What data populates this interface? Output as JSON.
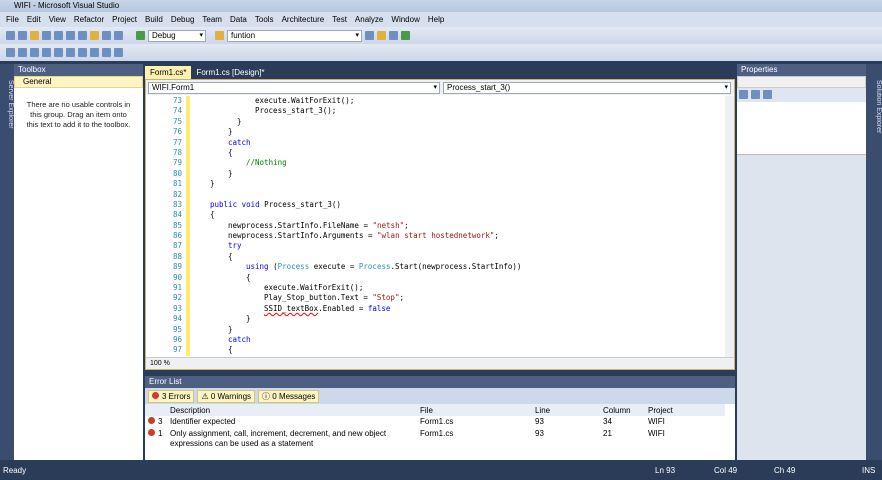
{
  "window": {
    "title": "WIFI - Microsoft Visual Studio"
  },
  "menu": [
    "File",
    "Edit",
    "View",
    "Refactor",
    "Project",
    "Build",
    "Debug",
    "Team",
    "Data",
    "Tools",
    "Architecture",
    "Test",
    "Analyze",
    "Window",
    "Help"
  ],
  "toolbar": {
    "config": "Debug",
    "find": "funtion"
  },
  "side_strips": {
    "left": "Server Explorer",
    "right": "Solution Explorer"
  },
  "toolbox": {
    "title": "Toolbox",
    "group": "General",
    "empty_text": "There are no usable controls in this group. Drag an item onto this text to add it to the toolbox."
  },
  "tabs": [
    {
      "label": "Form1.cs*",
      "active": true
    },
    {
      "label": "Form1.cs [Design]*",
      "active": false
    }
  ],
  "editor": {
    "class_combo": "WIFI.Form1",
    "member_combo": "Process_start_3()",
    "zoom": "100 %",
    "lines": [
      {
        "n": "73",
        "i": 3,
        "t": [
          [
            "",
            "execute.WaitForExit();"
          ]
        ]
      },
      {
        "n": "74",
        "i": 3,
        "t": [
          [
            "",
            "Process_start_3();"
          ]
        ]
      },
      {
        "n": "75",
        "i": 2,
        "t": [
          [
            "",
            "}"
          ]
        ]
      },
      {
        "n": "76",
        "i": 1.5,
        "t": [
          [
            "",
            "}"
          ]
        ]
      },
      {
        "n": "77",
        "i": 1.5,
        "t": [
          [
            "kw",
            "catch"
          ]
        ]
      },
      {
        "n": "78",
        "i": 1.5,
        "t": [
          [
            "",
            "{"
          ]
        ]
      },
      {
        "n": "79",
        "i": 2.5,
        "t": [
          [
            "cm",
            "//Nothing"
          ]
        ]
      },
      {
        "n": "80",
        "i": 1.5,
        "t": [
          [
            "",
            "}"
          ]
        ]
      },
      {
        "n": "81",
        "i": 0.5,
        "t": [
          [
            "",
            "}"
          ]
        ]
      },
      {
        "n": "82",
        "i": 0,
        "t": []
      },
      {
        "n": "83",
        "i": 0.5,
        "t": [
          [
            "kw",
            "public"
          ],
          [
            "",
            " "
          ],
          [
            "kw",
            "void"
          ],
          [
            "",
            " Process_start_3()"
          ]
        ]
      },
      {
        "n": "84",
        "i": 0.5,
        "t": [
          [
            "",
            "{"
          ]
        ]
      },
      {
        "n": "85",
        "i": 1.5,
        "t": [
          [
            "",
            "newprocess.StartInfo.FileName = "
          ],
          [
            "str",
            "\"netsh\""
          ],
          [
            "",
            ";"
          ]
        ]
      },
      {
        "n": "86",
        "i": 1.5,
        "t": [
          [
            "",
            "newprocess.StartInfo.Arguments = "
          ],
          [
            "str",
            "\"wlan start hostednetwork\""
          ],
          [
            "",
            ";"
          ]
        ]
      },
      {
        "n": "87",
        "i": 1.5,
        "t": [
          [
            "kw",
            "try"
          ]
        ]
      },
      {
        "n": "88",
        "i": 1.5,
        "t": [
          [
            "",
            "{"
          ]
        ]
      },
      {
        "n": "89",
        "i": 2.5,
        "t": [
          [
            "kw",
            "using"
          ],
          [
            "",
            " ("
          ],
          [
            "ty",
            "Process"
          ],
          [
            "",
            " execute = "
          ],
          [
            "ty",
            "Process"
          ],
          [
            "",
            ".Start(newprocess.StartInfo))"
          ]
        ]
      },
      {
        "n": "90",
        "i": 2.5,
        "t": [
          [
            "",
            "{"
          ]
        ]
      },
      {
        "n": "91",
        "i": 3.5,
        "t": [
          [
            "",
            "execute.WaitForExit();"
          ]
        ]
      },
      {
        "n": "92",
        "i": 3.5,
        "t": [
          [
            "",
            "Play_Stop_button.Text = "
          ],
          [
            "str",
            "\"Stop\""
          ],
          [
            "",
            ";"
          ]
        ]
      },
      {
        "n": "93",
        "i": 3.5,
        "t": [
          [
            "err",
            "SSID_textBox"
          ],
          [
            "",
            ".Enabled = "
          ],
          [
            "kw",
            "false"
          ]
        ]
      },
      {
        "n": "94",
        "i": 2.5,
        "t": [
          [
            "",
            "}"
          ]
        ]
      },
      {
        "n": "95",
        "i": 1.5,
        "t": [
          [
            "",
            "}"
          ]
        ]
      },
      {
        "n": "96",
        "i": 1.5,
        "t": [
          [
            "kw",
            "catch"
          ]
        ]
      },
      {
        "n": "97",
        "i": 1.5,
        "t": [
          [
            "",
            "{"
          ]
        ]
      }
    ]
  },
  "error_list": {
    "title": "Error List",
    "errors_btn": "3 Errors",
    "warnings_btn": "0 Warnings",
    "messages_btn": "0 Messages",
    "columns": [
      "Description",
      "File",
      "Line",
      "Column",
      "Project"
    ],
    "rows": [
      {
        "num": "3",
        "description": "Identifier expected",
        "file": "Form1.cs",
        "line": "93",
        "column": "34",
        "project": "WIFI"
      },
      {
        "num": "1",
        "description": "Only assignment, call, increment, decrement, and new object expressions can be used as a statement",
        "file": "Form1.cs",
        "line": "93",
        "column": "21",
        "project": "WIFI"
      }
    ]
  },
  "properties": {
    "title": "Properties"
  },
  "status": {
    "text": "Ready",
    "ln": "Ln 93",
    "col": "Col 49",
    "ch": "Ch 49",
    "mode": "INS"
  }
}
